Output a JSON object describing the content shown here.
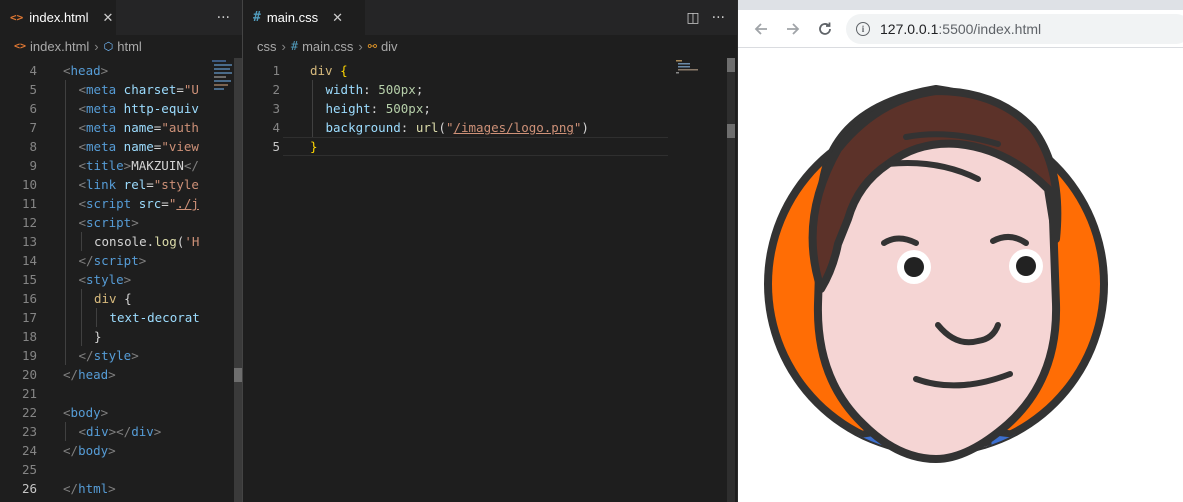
{
  "left_editor": {
    "tab": {
      "icon": "<>",
      "label": "index.html",
      "close": "✕"
    },
    "actions": {
      "more": "···"
    },
    "breadcrumb": {
      "file": "index.html",
      "node": "html"
    },
    "lines": [
      {
        "n": "4",
        "indent": 0,
        "tokens": [
          [
            "tag",
            "<"
          ],
          [
            "tn",
            "head"
          ],
          [
            "tag",
            ">"
          ]
        ]
      },
      {
        "n": "5",
        "indent": 1,
        "tokens": [
          [
            "tag",
            "<"
          ],
          [
            "tn",
            "meta"
          ],
          [
            "tx",
            " "
          ],
          [
            "at",
            "charset"
          ],
          [
            "tx",
            "="
          ],
          [
            "st",
            "\"U"
          ]
        ]
      },
      {
        "n": "6",
        "indent": 1,
        "tokens": [
          [
            "tag",
            "<"
          ],
          [
            "tn",
            "meta"
          ],
          [
            "tx",
            " "
          ],
          [
            "at",
            "http-equiv"
          ]
        ]
      },
      {
        "n": "7",
        "indent": 1,
        "tokens": [
          [
            "tag",
            "<"
          ],
          [
            "tn",
            "meta"
          ],
          [
            "tx",
            " "
          ],
          [
            "at",
            "name"
          ],
          [
            "tx",
            "="
          ],
          [
            "st",
            "\"auth"
          ]
        ]
      },
      {
        "n": "8",
        "indent": 1,
        "tokens": [
          [
            "tag",
            "<"
          ],
          [
            "tn",
            "meta"
          ],
          [
            "tx",
            " "
          ],
          [
            "at",
            "name"
          ],
          [
            "tx",
            "="
          ],
          [
            "st",
            "\"view"
          ]
        ]
      },
      {
        "n": "9",
        "indent": 1,
        "tokens": [
          [
            "tag",
            "<"
          ],
          [
            "tn",
            "title"
          ],
          [
            "tag",
            ">"
          ],
          [
            "tx",
            "MAKZUIN"
          ],
          [
            "tag",
            "</"
          ]
        ]
      },
      {
        "n": "10",
        "indent": 1,
        "tokens": [
          [
            "tag",
            "<"
          ],
          [
            "tn",
            "link"
          ],
          [
            "tx",
            " "
          ],
          [
            "at",
            "rel"
          ],
          [
            "tx",
            "="
          ],
          [
            "st",
            "\"style"
          ]
        ]
      },
      {
        "n": "11",
        "indent": 1,
        "tokens": [
          [
            "tag",
            "<"
          ],
          [
            "tn",
            "script"
          ],
          [
            "tx",
            " "
          ],
          [
            "at",
            "src"
          ],
          [
            "tx",
            "="
          ],
          [
            "st",
            "\""
          ],
          [
            "st ul",
            "./j"
          ]
        ]
      },
      {
        "n": "12",
        "indent": 1,
        "tokens": [
          [
            "tag",
            "<"
          ],
          [
            "tn",
            "script"
          ],
          [
            "tag",
            ">"
          ]
        ]
      },
      {
        "n": "13",
        "indent": 2,
        "tokens": [
          [
            "tx",
            "console."
          ],
          [
            "fn",
            "log"
          ],
          [
            "tx",
            "("
          ],
          [
            "st",
            "'H"
          ]
        ]
      },
      {
        "n": "14",
        "indent": 1,
        "tokens": [
          [
            "tag",
            "</"
          ],
          [
            "tn",
            "script"
          ],
          [
            "tag",
            ">"
          ]
        ]
      },
      {
        "n": "15",
        "indent": 1,
        "tokens": [
          [
            "tag",
            "<"
          ],
          [
            "tn",
            "style"
          ],
          [
            "tag",
            ">"
          ]
        ]
      },
      {
        "n": "16",
        "indent": 2,
        "tokens": [
          [
            "sel",
            "div"
          ],
          [
            "tx",
            " {"
          ]
        ]
      },
      {
        "n": "17",
        "indent": 3,
        "tokens": [
          [
            "pr",
            "text-decorat"
          ]
        ]
      },
      {
        "n": "18",
        "indent": 2,
        "tokens": [
          [
            "tx",
            "}"
          ]
        ]
      },
      {
        "n": "19",
        "indent": 1,
        "tokens": [
          [
            "tag",
            "</"
          ],
          [
            "tn",
            "style"
          ],
          [
            "tag",
            ">"
          ]
        ]
      },
      {
        "n": "20",
        "indent": 0,
        "tokens": [
          [
            "tag",
            "</"
          ],
          [
            "tn",
            "head"
          ],
          [
            "tag",
            ">"
          ]
        ]
      },
      {
        "n": "21",
        "indent": 0,
        "tokens": []
      },
      {
        "n": "22",
        "indent": 0,
        "tokens": [
          [
            "tag",
            "<"
          ],
          [
            "tn",
            "body"
          ],
          [
            "tag",
            ">"
          ]
        ]
      },
      {
        "n": "23",
        "indent": 1,
        "tokens": [
          [
            "tag",
            "<"
          ],
          [
            "tn",
            "div"
          ],
          [
            "tag",
            "></"
          ],
          [
            "tn",
            "div"
          ],
          [
            "tag",
            ">"
          ]
        ]
      },
      {
        "n": "24",
        "indent": 0,
        "tokens": [
          [
            "tag",
            "</"
          ],
          [
            "tn",
            "body"
          ],
          [
            "tag",
            ">"
          ]
        ]
      },
      {
        "n": "25",
        "indent": 0,
        "tokens": []
      },
      {
        "n": "26",
        "indent": 0,
        "current": true,
        "tokens": [
          [
            "tag",
            "</"
          ],
          [
            "tn",
            "html"
          ],
          [
            "tag",
            ">"
          ]
        ]
      }
    ]
  },
  "mid_editor": {
    "tab": {
      "icon": "#",
      "label": "main.css",
      "close": "✕"
    },
    "actions": {
      "split": "◫",
      "more": "···"
    },
    "breadcrumb": {
      "folder": "css",
      "file": "main.css",
      "rule": "div"
    },
    "lines": [
      {
        "n": "1",
        "indent": 0,
        "tokens": [
          [
            "sel",
            "div"
          ],
          [
            "tx",
            " "
          ],
          [
            "br",
            "{"
          ]
        ]
      },
      {
        "n": "2",
        "indent": 1,
        "tokens": [
          [
            "pr",
            "width"
          ],
          [
            "tx",
            ": "
          ],
          [
            "nu",
            "500px"
          ],
          [
            "tx",
            ";"
          ]
        ]
      },
      {
        "n": "3",
        "indent": 1,
        "tokens": [
          [
            "pr",
            "height"
          ],
          [
            "tx",
            ": "
          ],
          [
            "nu",
            "500px"
          ],
          [
            "tx",
            ";"
          ]
        ]
      },
      {
        "n": "4",
        "indent": 1,
        "tokens": [
          [
            "pr",
            "background"
          ],
          [
            "tx",
            ": "
          ],
          [
            "fn",
            "url"
          ],
          [
            "tx",
            "("
          ],
          [
            "st",
            "\""
          ],
          [
            "st ul",
            "/images/logo.png"
          ],
          [
            "st",
            "\""
          ],
          [
            "tx",
            ")"
          ]
        ]
      },
      {
        "n": "5",
        "indent": 0,
        "current": true,
        "tokens": [
          [
            "br",
            "}"
          ]
        ]
      }
    ]
  },
  "browser": {
    "url_host": "127.0.0.1",
    "url_rest": ":5500/index.html",
    "info_glyph": "i",
    "colors": {
      "orange": "#ff6d05",
      "blue": "#3c6fcf",
      "hair": "#5c3229",
      "skin": "#f5d5d4",
      "outline": "#333333"
    }
  }
}
